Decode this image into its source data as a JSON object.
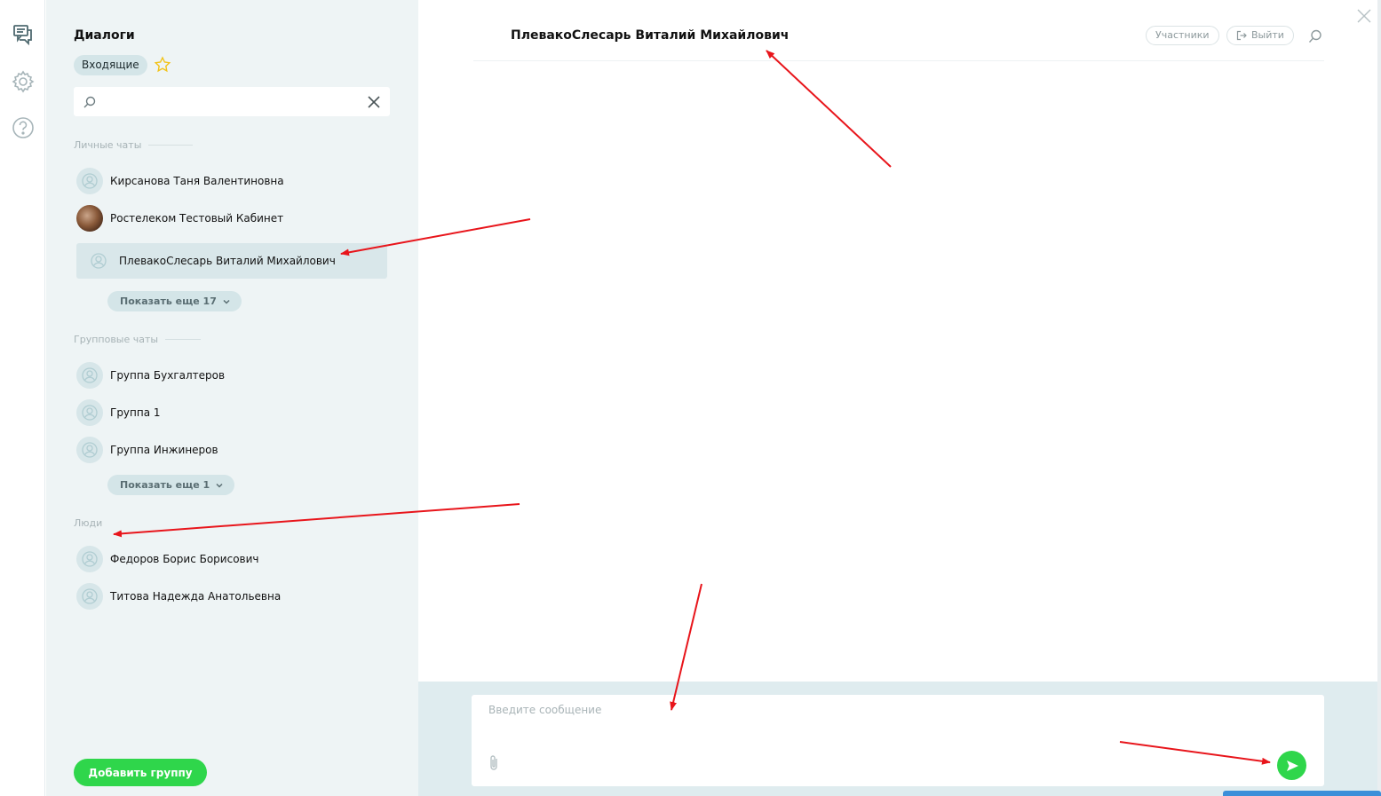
{
  "panel": {
    "title": "Диалоги",
    "inbox_label": "Входящие",
    "search": {
      "value": "",
      "placeholder": ""
    },
    "sections": {
      "personal": "Личные чаты",
      "groups": "Групповые чаты",
      "people": "Люди"
    },
    "personal_chats": [
      {
        "name": "Кирсанова Таня Валентиновна",
        "avatar": "default"
      },
      {
        "name": "Ростелеком Тестовый Кабинет",
        "avatar": "photo"
      },
      {
        "name": "ПлевакоСлесарь Виталий Михайлович",
        "avatar": "default",
        "active": true
      }
    ],
    "personal_more": "Показать еще 17",
    "group_chats": [
      {
        "name": "Группа Бухгалтеров"
      },
      {
        "name": "Группа 1"
      },
      {
        "name": "Группа Инжинеров"
      }
    ],
    "groups_more": "Показать еще 1",
    "people": [
      {
        "name": "Федоров Борис Борисович"
      },
      {
        "name": "Титова Надежда Анатольевна"
      }
    ],
    "add_group_label": "Добавить группу"
  },
  "chat": {
    "title": "ПлевакоСлесарь Виталий Михайлович",
    "participants_label": "Участники",
    "exit_label": "Выйти",
    "composer_placeholder": "Введите сообщение"
  },
  "colors": {
    "accent_green": "#2fd64b",
    "panel_bg": "#eef4f5",
    "chip_bg": "#d4e5e8",
    "annotation_red": "#e8151b"
  },
  "icons": {
    "rail": [
      "chat-icon",
      "gear-icon",
      "help-icon"
    ],
    "panel": [
      "star-icon",
      "search-icon",
      "clear-icon",
      "user-icon",
      "chevron-down-icon"
    ],
    "chat": [
      "search-icon",
      "close-icon",
      "exit-icon",
      "paperclip-icon",
      "send-icon"
    ]
  }
}
